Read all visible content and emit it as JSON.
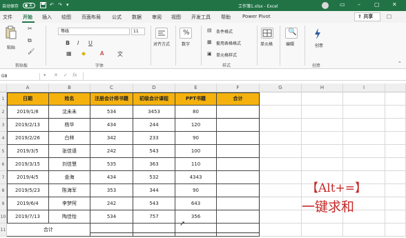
{
  "titlebar": {
    "autosave_label": "自动保存",
    "autosave_state": "关",
    "title": "工作簿1.xlsx - Excel",
    "save_icon": "save-icon",
    "undo_icon": "undo-icon",
    "redo_icon": "redo-icon"
  },
  "menu": {
    "tabs": [
      "文件",
      "开始",
      "插入",
      "绘图",
      "页面布局",
      "公式",
      "数据",
      "审阅",
      "视图",
      "开发工具",
      "帮助",
      "Power Pivot"
    ],
    "active": "开始",
    "share": "共享"
  },
  "ribbon": {
    "paste": "粘贴",
    "clipboard_group": "剪贴板",
    "font_name": "等线",
    "font_size": "11",
    "font_group": "字体",
    "align_label": "对齐方式",
    "number_label": "数字",
    "cond_format": "条件格式",
    "table_format": "套用表格格式",
    "cell_style": "单元格样式",
    "style_group": "样式",
    "cells_label": "单元格",
    "editing_label": "编辑",
    "ideas_label": "创意",
    "ideas_group": "创意",
    "bold": "B",
    "italic": "I",
    "underline": "U"
  },
  "formula_bar": {
    "name_box": "G8",
    "fx": "fx"
  },
  "sheet": {
    "columns": [
      "A",
      "B",
      "C",
      "D",
      "E",
      "F",
      "G",
      "H",
      "I"
    ],
    "rows": [
      "1",
      "2",
      "3",
      "4",
      "5",
      "6",
      "7",
      "8",
      "9",
      "10",
      "11"
    ],
    "headers": [
      "日期",
      "姓名",
      "注册会计师书籍",
      "初级会计课程",
      "PPT书籍",
      "合计"
    ],
    "data": [
      [
        "2019/1/8",
        "沈未未",
        "534",
        "3453",
        "80",
        ""
      ],
      [
        "2019/2/13",
        "杨华",
        "434",
        "244",
        "120",
        ""
      ],
      [
        "2019/2/26",
        "白林",
        "342",
        "233",
        "90",
        ""
      ],
      [
        "2019/3/5",
        "张佳语",
        "242",
        "543",
        "100",
        ""
      ],
      [
        "2019/3/15",
        "刘佳慧",
        "535",
        "363",
        "110",
        ""
      ],
      [
        "2019/4/5",
        "金海",
        "434",
        "532",
        "4343",
        ""
      ],
      [
        "2019/5/23",
        "陈海军",
        "353",
        "344",
        "90",
        ""
      ],
      [
        "2019/6/4",
        "李梦阿",
        "242",
        "543",
        "643",
        ""
      ],
      [
        "2019/7/13",
        "陶佳怡",
        "534",
        "757",
        "356",
        ""
      ]
    ],
    "total_label": "合计"
  },
  "overlay": {
    "shortcut": "【Alt+=】",
    "caption": "一键求和"
  }
}
